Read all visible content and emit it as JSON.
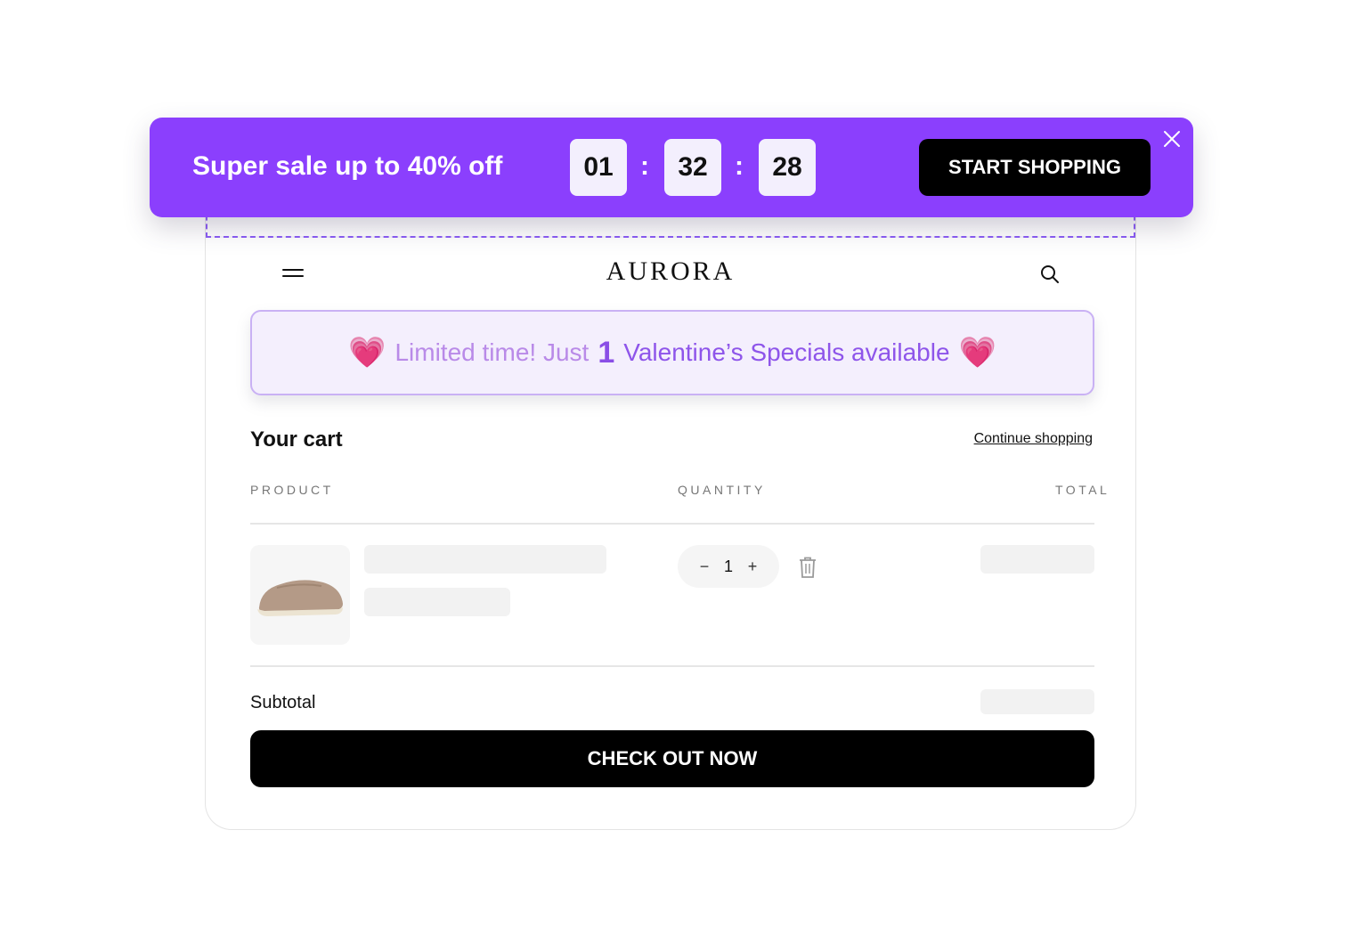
{
  "sale_bar": {
    "headline": "Super sale up to 40% off",
    "timer": {
      "hours": "01",
      "minutes": "32",
      "seconds": "28",
      "separator": ":"
    },
    "cta_label": "START SHOPPING",
    "close_icon": "close-icon",
    "background_color": "#8b3ffd"
  },
  "store": {
    "brand": "AURORA",
    "menu_icon": "hamburger-menu-icon",
    "search_icon": "search-icon"
  },
  "promo_banner": {
    "heart_emoji": "💗",
    "prefix": "Limited time! Just",
    "count": "1",
    "suffix": "Valentine’s Specials available"
  },
  "cart": {
    "title": "Your cart",
    "continue_link": "Continue shopping",
    "columns": {
      "product": "PRODUCT",
      "quantity": "QUANTITY",
      "total": "TOTAL"
    },
    "item": {
      "image": "beige slip-on shoe",
      "quantity": "1",
      "minus": "−",
      "plus": "+",
      "trash_icon": "trash-icon"
    },
    "subtotal_label": "Subtotal",
    "checkout_label": "CHECK OUT NOW"
  }
}
